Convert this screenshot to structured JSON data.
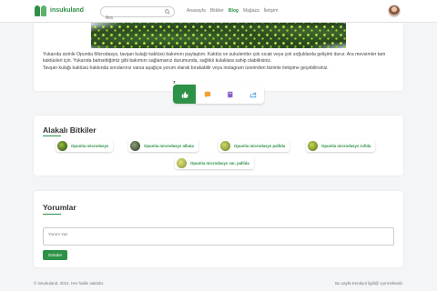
{
  "header": {
    "logo_text": "insukuland",
    "search_placeholder": "Ara",
    "nav": [
      "Anasayfa",
      "Bitkiler",
      "Blog",
      "Mağaza",
      "İletişim"
    ],
    "active_nav": "Blog"
  },
  "article": {
    "paragraph1": "Yukarıda sizinle Opuntia Microdasys, tavşan kulağı kaktüsü bakımını paylaştım. Kaktüs ve sukulentler çok sıcak veya çok soğuklarda gelişimi durur. Ara mevsimler tam kaktüsleri için. Yukarıda bahsettiğimiz gibi bakımını sağlamanız durumunda, sağlıklı kulaklara sahip olabilirsiniz.",
    "paragraph2": "Tavşan kulağı kaktüsü hakkında sorularınız varsa aşağıya yorum olarak bırakabilir veya instagram üzerinden bizimle iletişime geçebilirsiniz."
  },
  "actions": {
    "like_count": "7",
    "icons": [
      "thumbs-up-icon",
      "comment-icon",
      "bookmark-icon",
      "share-icon"
    ],
    "accent_color": "#2e9148"
  },
  "related": {
    "title": "Alakalı Bitkiler",
    "items": [
      {
        "label": "Opuntia microdasys"
      },
      {
        "label": "Opuntia microdasys albata"
      },
      {
        "label": "Opuntia microdasys pallida"
      },
      {
        "label": "Opuntia microdasys rufida"
      },
      {
        "label": "Opuntia microdasys var. pallida"
      }
    ]
  },
  "comments": {
    "title": "Yorumlar",
    "placeholder": "Yorum Yaz",
    "submit_label": "Gönder"
  },
  "footer": {
    "left": "© insukuland, 2021. Her hakkı saklıdır.",
    "right": "Bu sayfa trendyol ilgili@ içermektedir."
  }
}
